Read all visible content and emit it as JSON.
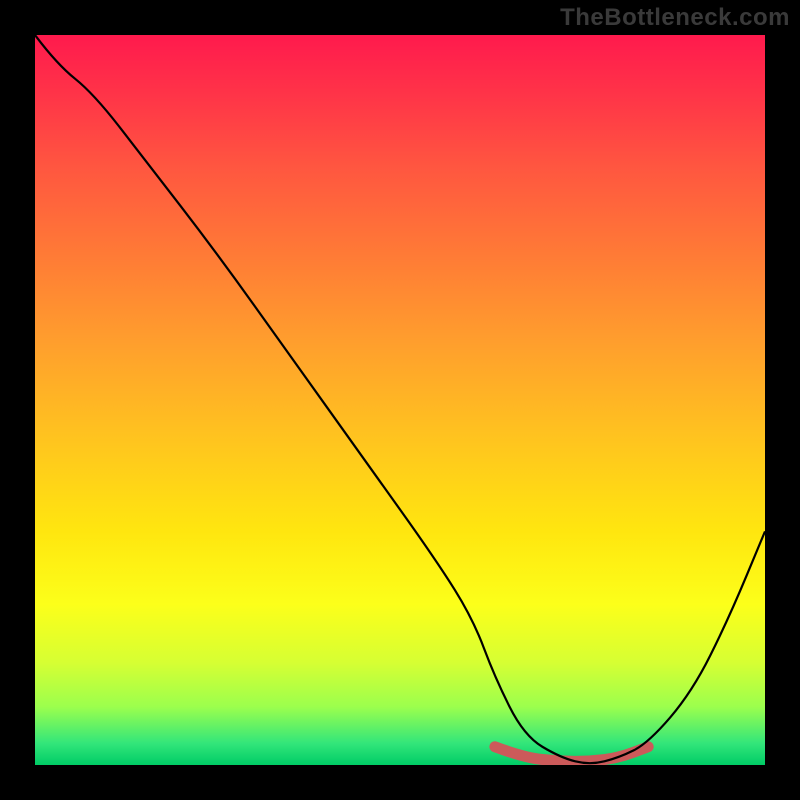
{
  "watermark": "TheBottleneck.com",
  "chart_data": {
    "type": "line",
    "title": "",
    "xlabel": "",
    "ylabel": "",
    "xlim": [
      0,
      100
    ],
    "ylim": [
      0,
      100
    ],
    "grid": false,
    "legend": false,
    "series": [
      {
        "name": "bottleneck-curve",
        "x": [
          0,
          3,
          8,
          15,
          25,
          35,
          45,
          55,
          60,
          63,
          67,
          72,
          76,
          80,
          84,
          90,
          95,
          100
        ],
        "y": [
          100,
          96,
          92,
          83,
          70,
          56,
          42,
          28,
          20,
          12,
          4,
          1,
          0,
          1,
          3,
          10,
          20,
          32
        ]
      }
    ],
    "highlight": {
      "name": "optimal-range",
      "x": [
        63,
        67,
        72,
        76,
        80,
        84
      ],
      "y": [
        2.5,
        1.0,
        0.5,
        0.5,
        1.0,
        2.5
      ],
      "color": "#cc5a5a"
    },
    "background_gradient": {
      "top": "#ff1a4d",
      "mid": "#ffe60f",
      "bottom": "#00cc66"
    }
  }
}
